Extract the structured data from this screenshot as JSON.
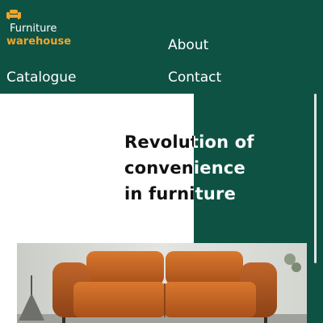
{
  "brand": {
    "line1": "Furniture",
    "line2": "warehouse",
    "icon": "sofa-icon",
    "accent_color": "#f0a52a"
  },
  "nav": {
    "about": "About",
    "catalogue": "Catalogue",
    "contact": "Contact"
  },
  "hero": {
    "heading_lines": [
      "Revolution of",
      "convenience",
      "in furniture"
    ],
    "image_icon": "orange-leather-sofa-photo"
  },
  "theme": {
    "primary": "#0e5244",
    "background": "#ffffff"
  }
}
